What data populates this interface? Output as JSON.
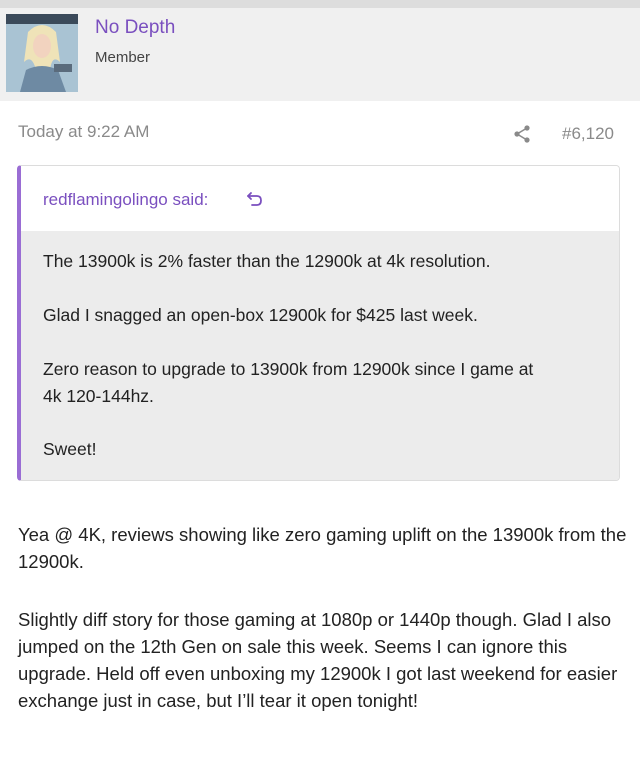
{
  "user": {
    "name": "No Depth",
    "title": "Member"
  },
  "post": {
    "timestamp": "Today at 9:22 AM",
    "number": "#6,120"
  },
  "quote": {
    "author": "redflamingolingo said:",
    "lines": [
      "The 13900k is 2% faster than the 12900k at 4k resolution.",
      "Glad I snagged an open-box 12900k for $425 last week.",
      "Zero reason to upgrade to 13900k from 12900k since I game at",
      "4k 120-144hz.",
      "Sweet!"
    ]
  },
  "reply": {
    "paragraph1": "Yea @ 4K, reviews showing like zero gaming uplift on the 13900k from the 12900k.",
    "paragraph2": "Slightly diff story for those gaming at 1080p or 1440p though. Glad I also jumped on the 12th Gen on sale this week. Seems I can ignore this upgrade. Held off even unboxing my 12900k I got last weekend for easier exchange just in case, but I’ll tear it open tonight!"
  },
  "colors": {
    "accent": "#7a4fbf",
    "quote_border": "#9a6dd4",
    "quote_bg": "#ececec",
    "meta": "#8a8a8a"
  },
  "icons": [
    "share-icon",
    "jump-to-quote-icon"
  ]
}
